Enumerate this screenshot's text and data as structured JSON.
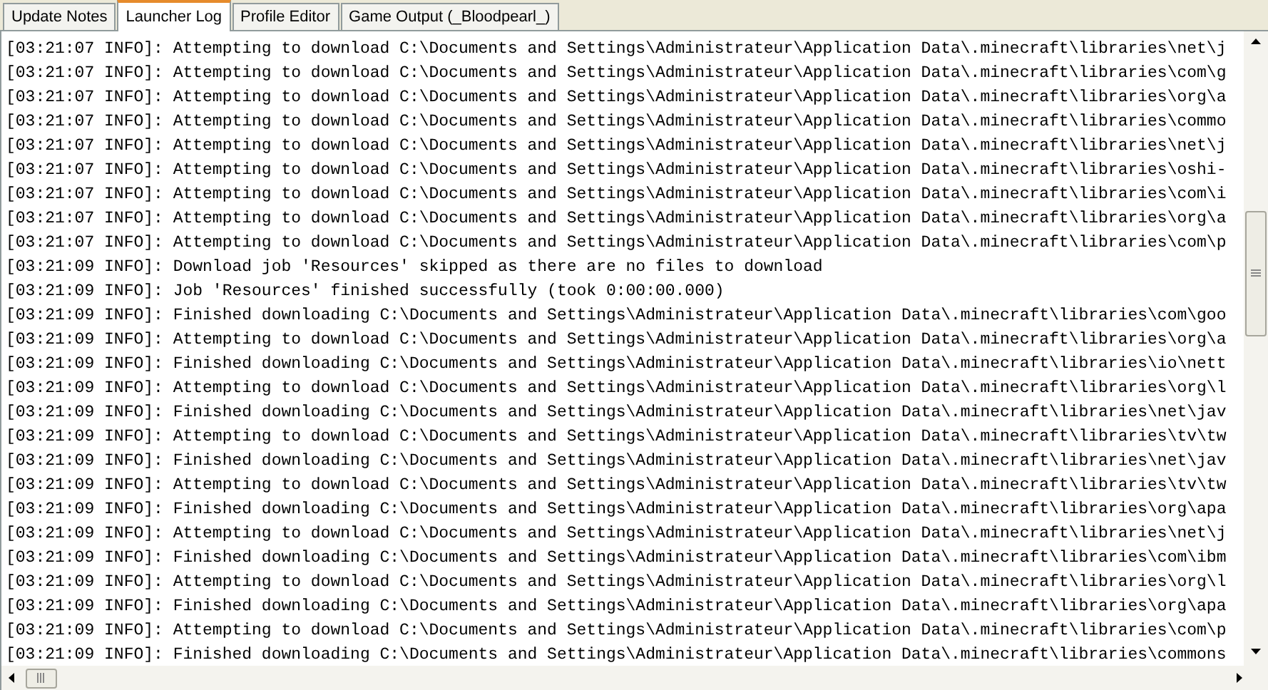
{
  "tabs": [
    {
      "label": "Update Notes",
      "selected": false
    },
    {
      "label": "Launcher Log",
      "selected": true
    },
    {
      "label": "Profile Editor",
      "selected": false
    },
    {
      "label": "Game Output (_Bloodpearl_)",
      "selected": false
    }
  ],
  "log_lines": [
    "[03:21:07 INFO]: Attempting to download C:\\Documents and Settings\\Administrateur\\Application Data\\.minecraft\\libraries\\net\\j",
    "[03:21:07 INFO]: Attempting to download C:\\Documents and Settings\\Administrateur\\Application Data\\.minecraft\\libraries\\com\\g",
    "[03:21:07 INFO]: Attempting to download C:\\Documents and Settings\\Administrateur\\Application Data\\.minecraft\\libraries\\org\\a",
    "[03:21:07 INFO]: Attempting to download C:\\Documents and Settings\\Administrateur\\Application Data\\.minecraft\\libraries\\commo",
    "[03:21:07 INFO]: Attempting to download C:\\Documents and Settings\\Administrateur\\Application Data\\.minecraft\\libraries\\net\\j",
    "[03:21:07 INFO]: Attempting to download C:\\Documents and Settings\\Administrateur\\Application Data\\.minecraft\\libraries\\oshi-",
    "[03:21:07 INFO]: Attempting to download C:\\Documents and Settings\\Administrateur\\Application Data\\.minecraft\\libraries\\com\\i",
    "[03:21:07 INFO]: Attempting to download C:\\Documents and Settings\\Administrateur\\Application Data\\.minecraft\\libraries\\org\\a",
    "[03:21:07 INFO]: Attempting to download C:\\Documents and Settings\\Administrateur\\Application Data\\.minecraft\\libraries\\com\\p",
    "[03:21:09 INFO]: Download job 'Resources' skipped as there are no files to download",
    "[03:21:09 INFO]: Job 'Resources' finished successfully (took 0:00:00.000)",
    "[03:21:09 INFO]: Finished downloading C:\\Documents and Settings\\Administrateur\\Application Data\\.minecraft\\libraries\\com\\goo",
    "[03:21:09 INFO]: Attempting to download C:\\Documents and Settings\\Administrateur\\Application Data\\.minecraft\\libraries\\org\\a",
    "[03:21:09 INFO]: Finished downloading C:\\Documents and Settings\\Administrateur\\Application Data\\.minecraft\\libraries\\io\\nett",
    "[03:21:09 INFO]: Attempting to download C:\\Documents and Settings\\Administrateur\\Application Data\\.minecraft\\libraries\\org\\l",
    "[03:21:09 INFO]: Finished downloading C:\\Documents and Settings\\Administrateur\\Application Data\\.minecraft\\libraries\\net\\jav",
    "[03:21:09 INFO]: Attempting to download C:\\Documents and Settings\\Administrateur\\Application Data\\.minecraft\\libraries\\tv\\tw",
    "[03:21:09 INFO]: Finished downloading C:\\Documents and Settings\\Administrateur\\Application Data\\.minecraft\\libraries\\net\\jav",
    "[03:21:09 INFO]: Attempting to download C:\\Documents and Settings\\Administrateur\\Application Data\\.minecraft\\libraries\\tv\\tw",
    "[03:21:09 INFO]: Finished downloading C:\\Documents and Settings\\Administrateur\\Application Data\\.minecraft\\libraries\\org\\apa",
    "[03:21:09 INFO]: Attempting to download C:\\Documents and Settings\\Administrateur\\Application Data\\.minecraft\\libraries\\net\\j",
    "[03:21:09 INFO]: Finished downloading C:\\Documents and Settings\\Administrateur\\Application Data\\.minecraft\\libraries\\com\\ibm",
    "[03:21:09 INFO]: Attempting to download C:\\Documents and Settings\\Administrateur\\Application Data\\.minecraft\\libraries\\org\\l",
    "[03:21:09 INFO]: Finished downloading C:\\Documents and Settings\\Administrateur\\Application Data\\.minecraft\\libraries\\org\\apa",
    "[03:21:09 INFO]: Attempting to download C:\\Documents and Settings\\Administrateur\\Application Data\\.minecraft\\libraries\\com\\p",
    "[03:21:09 INFO]: Finished downloading C:\\Documents and Settings\\Administrateur\\Application Data\\.minecraft\\libraries\\commons"
  ]
}
